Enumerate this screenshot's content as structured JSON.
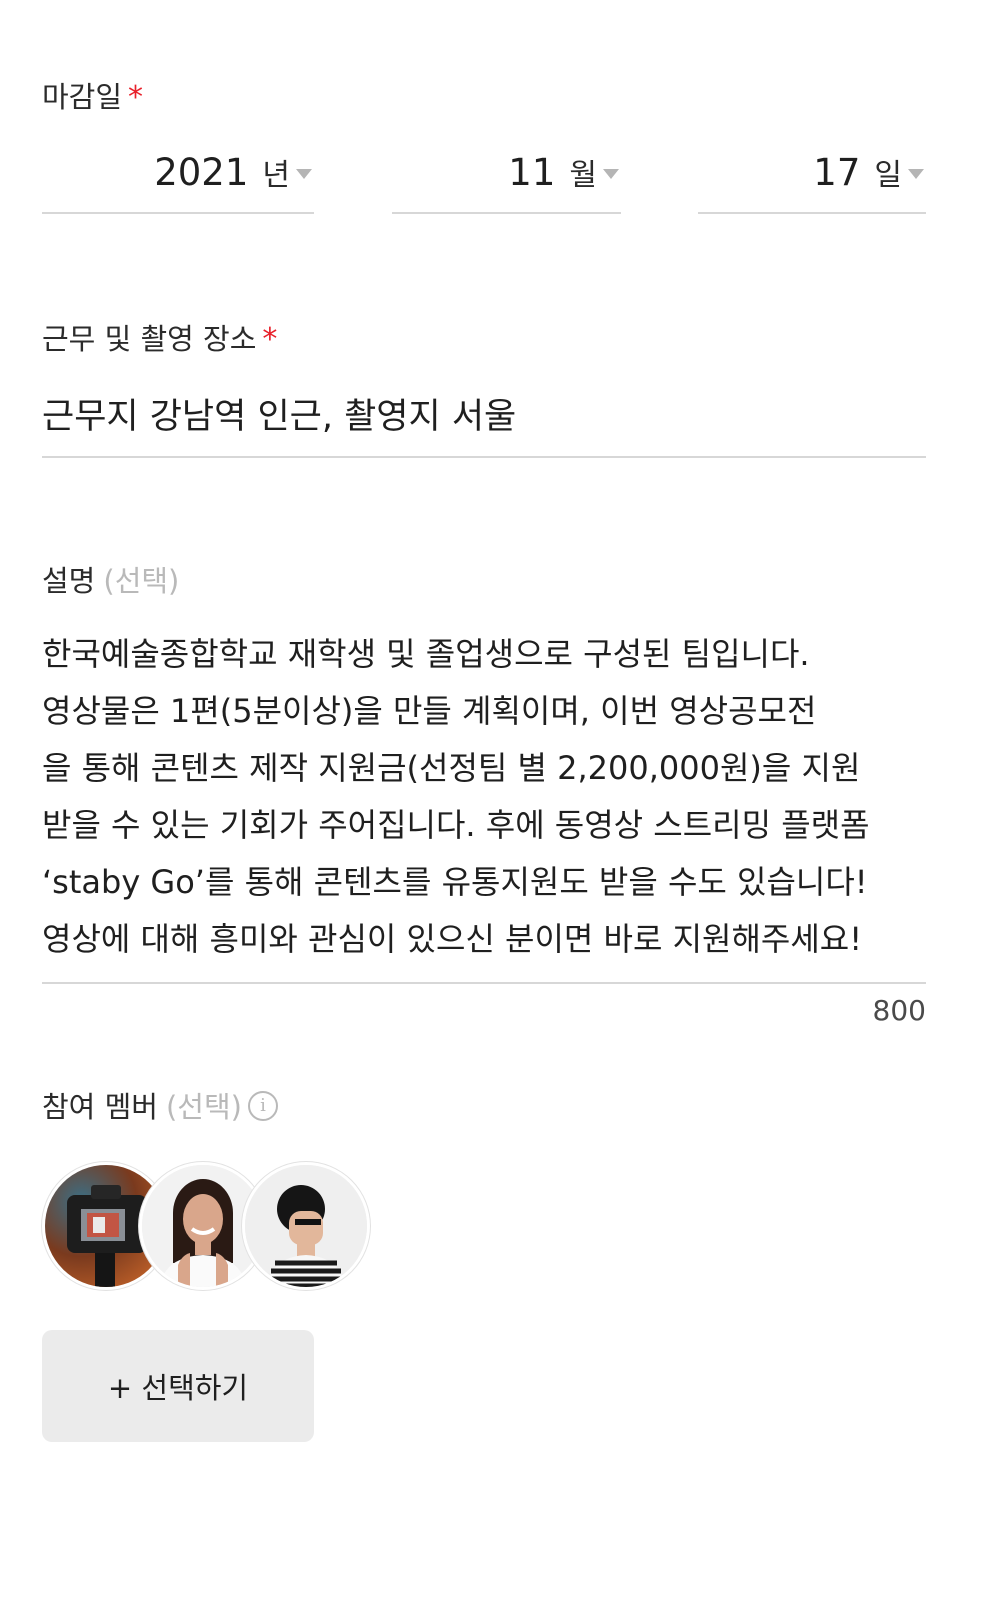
{
  "deadline": {
    "label": "마감일",
    "required_mark": "*",
    "year": {
      "value": "2021",
      "unit": "년"
    },
    "month": {
      "value": "11",
      "unit": "월"
    },
    "day": {
      "value": "17",
      "unit": "일"
    }
  },
  "location": {
    "label": "근무 및 촬영 장소",
    "required_mark": "*",
    "value": "근무지 강남역 인근, 촬영지 서울"
  },
  "description": {
    "label": "설명",
    "optional_text": "(선택)",
    "lines": [
      "한국예술종합학교 재학생 및 졸업생으로 구성된 팀입니다.",
      "영상물은 1편(5분이상)을 만들 계획이며, 이번 영상공모전",
      "을 통해 콘텐츠 제작 지원금(선정팀 별 2,200,000원)을 지원",
      "받을 수 있는 기회가 주어집니다. 후에 동영상 스트리밍 플랫폼",
      "‘staby Go’를 통해 콘텐츠를 유통지원도 받을 수도 있습니다!",
      "영상에 대해 흥미와 관심이 있으신 분이면 바로 지원해주세요!"
    ],
    "counter": "800"
  },
  "members": {
    "label": "참여 멤버",
    "optional_text": "(선택)",
    "info_icon": "info-icon",
    "avatars": [
      "camera-avatar",
      "woman-avatar",
      "man-avatar"
    ],
    "select_button_label": "+ 선택하기"
  },
  "colors": {
    "required": "#e8202a",
    "optional_text": "#b9b9b9",
    "divider": "#d7d7d7",
    "button_bg": "#ebebeb"
  }
}
